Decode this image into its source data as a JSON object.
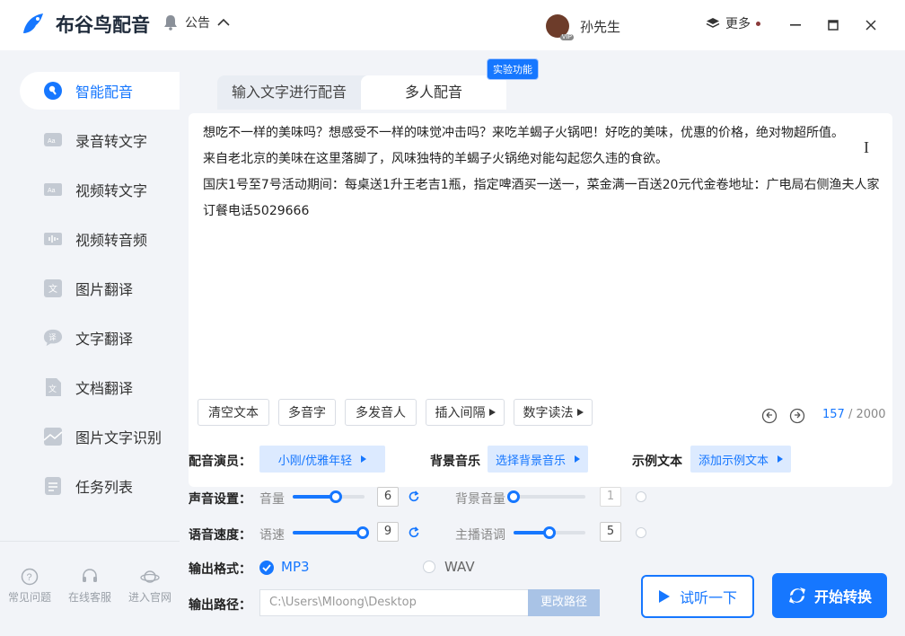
{
  "app": {
    "name": "布谷鸟配音",
    "notice_label": "公告",
    "user_name": "孙先生",
    "vip_label": "VIP",
    "more_label": "更多"
  },
  "sidebar": {
    "items": [
      {
        "label": "智能配音",
        "icon": "mic-icon"
      },
      {
        "label": "录音转文字",
        "icon": "audio-text-icon"
      },
      {
        "label": "视频转文字",
        "icon": "video-text-icon"
      },
      {
        "label": "视频转音频",
        "icon": "video-audio-icon"
      },
      {
        "label": "图片翻译",
        "icon": "image-translate-icon"
      },
      {
        "label": "文字翻译",
        "icon": "text-translate-icon"
      },
      {
        "label": "文档翻译",
        "icon": "doc-translate-icon"
      },
      {
        "label": "图片文字识别",
        "icon": "image-ocr-icon"
      },
      {
        "label": "任务列表",
        "icon": "task-list-icon"
      }
    ],
    "bottom": [
      {
        "label": "常见问题",
        "icon": "question-icon"
      },
      {
        "label": "在线客服",
        "icon": "headset-icon"
      },
      {
        "label": "进入官网",
        "icon": "planet-icon"
      }
    ]
  },
  "tabs": {
    "tab1": "输入文字进行配音",
    "tab2": "多人配音",
    "badge": "实验功能"
  },
  "editor": {
    "lines": [
      "想吃不一样的美味吗？想感受不一样的味觉冲击吗？来吃羊蝎子火锅吧！好吃的美味，优惠的价格，绝对物超所值。",
      "来自老北京的美味在这里落脚了，风味独特的羊蝎子火锅绝对能勾起您久违的食欲。",
      "国庆1号至7号活动期间：每桌送1升王老吉1瓶，指定啤酒买一送一，菜金满一百送20元代金卷地址：广电局右侧渔夫人家",
      "订餐电话5029666"
    ],
    "tools": {
      "clear": "清空文本",
      "polyphone": "多音字",
      "multi_speaker": "多发音人",
      "insert_pause": "插入间隔",
      "number_read": "数字读法"
    },
    "count_current": "157",
    "count_max": "/ 2000"
  },
  "settings": {
    "voice_label": "配音演员：",
    "voice_value": "小刚/优雅年轻",
    "bgm_label": "背景音乐",
    "bgm_value": "选择背景音乐",
    "example_label": "示例文本",
    "example_value": "添加示例文本",
    "sound_label": "声音设置：",
    "volume_label": "音量",
    "volume_value": "6",
    "volume_fraction": 0.6,
    "bg_volume_label": "背景音量",
    "bg_volume_value": "1",
    "bg_volume_fraction": 0.0,
    "speed_row_label": "语音速度：",
    "speed_label": "语速",
    "speed_value": "9",
    "speed_fraction": 1.0,
    "tone_label": "主播语调",
    "tone_value": "5",
    "tone_fraction": 0.5,
    "format_label": "输出格式：",
    "format_mp3": "MP3",
    "format_wav": "WAV",
    "path_label": "输出路径：",
    "path_value": "C:\\Users\\Mloong\\Desktop",
    "change_path": "更改路径",
    "listen_label": "试听一下",
    "start_label": "开始转换"
  },
  "colors": {
    "accent": "#1677ff",
    "accent_light": "#dceaff"
  }
}
